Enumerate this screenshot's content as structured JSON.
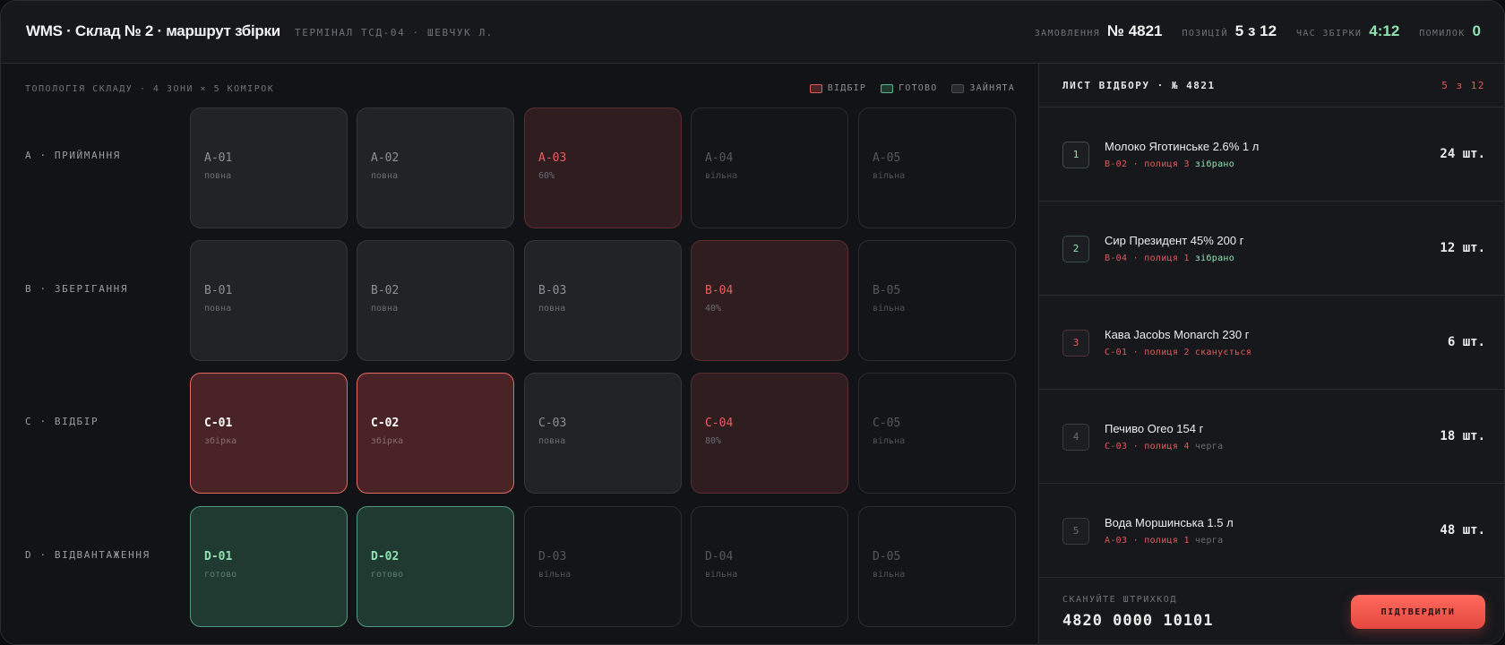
{
  "header": {
    "title": "WMS · Склад № 2 · маршрут збірки",
    "subtitle": "ТЕРМІНАЛ ТСД-04 · ШЕВЧУК Л.",
    "stats": [
      {
        "label": "ЗАМОВЛЕННЯ",
        "value": "№ 4821",
        "color": "#f2f2f2"
      },
      {
        "label": "ПОЗИЦІЙ",
        "value": "5 з 12",
        "color": "#f2f2f2"
      },
      {
        "label": "ЧАС ЗБІРКИ",
        "value": "4:12",
        "color": "#8ee3b1"
      },
      {
        "label": "ПОМИЛОК",
        "value": "0",
        "color": "#8ee3b1"
      }
    ]
  },
  "grid": {
    "topology_label": "ТОПОЛОГІЯ СКЛАДУ · 4 ЗОНИ × 5 КОМІРОК",
    "legend": [
      {
        "label": "ВІДБІР",
        "swatch": "red"
      },
      {
        "label": "ГОТОВО",
        "swatch": "green"
      },
      {
        "label": "ЗАЙНЯТА",
        "swatch": "gray"
      }
    ],
    "zones": [
      {
        "label": "A · ПРИЙМАННЯ",
        "cells": [
          {
            "code": "A-01",
            "sub": "повна",
            "state": "full"
          },
          {
            "code": "A-02",
            "sub": "повна",
            "state": "full"
          },
          {
            "code": "A-03",
            "sub": "60%",
            "state": "partial"
          },
          {
            "code": "A-04",
            "sub": "вільна",
            "state": "free"
          },
          {
            "code": "A-05",
            "sub": "вільна",
            "state": "free"
          }
        ]
      },
      {
        "label": "B · ЗБЕРІГАННЯ",
        "cells": [
          {
            "code": "B-01",
            "sub": "повна",
            "state": "full"
          },
          {
            "code": "B-02",
            "sub": "повна",
            "state": "full"
          },
          {
            "code": "B-03",
            "sub": "повна",
            "state": "full"
          },
          {
            "code": "B-04",
            "sub": "40%",
            "state": "partial"
          },
          {
            "code": "B-05",
            "sub": "вільна",
            "state": "free"
          }
        ]
      },
      {
        "label": "C · ВІДБІР",
        "cells": [
          {
            "code": "C-01",
            "sub": "збірка",
            "state": "pick"
          },
          {
            "code": "C-02",
            "sub": "збірка",
            "state": "pick"
          },
          {
            "code": "C-03",
            "sub": "повна",
            "state": "full"
          },
          {
            "code": "C-04",
            "sub": "80%",
            "state": "partial"
          },
          {
            "code": "C-05",
            "sub": "вільна",
            "state": "free"
          }
        ]
      },
      {
        "label": "D · ВІДВАНТАЖЕННЯ",
        "cells": [
          {
            "code": "D-01",
            "sub": "готово",
            "state": "done"
          },
          {
            "code": "D-02",
            "sub": "готово",
            "state": "done"
          },
          {
            "code": "D-03",
            "sub": "вільна",
            "state": "free"
          },
          {
            "code": "D-04",
            "sub": "вільна",
            "state": "free"
          },
          {
            "code": "D-05",
            "sub": "вільна",
            "state": "free"
          }
        ]
      }
    ]
  },
  "pick_list": {
    "title": "ЛИСТ ВІДБОРУ · № 4821",
    "count": "5 з 12",
    "items": [
      {
        "num": "1",
        "name": "Молоко Яготинське 2.6% 1 л",
        "location": "B-02 · полиця 3",
        "status": "зібрано",
        "status_color": "green",
        "qty": "24 шт."
      },
      {
        "num": "2",
        "name": "Сир Президент 45% 200 г",
        "location": "B-04 · полиця 1",
        "status": "зібрано",
        "status_color": "green",
        "qty": "12 шт."
      },
      {
        "num": "3",
        "name": "Кава Jacobs Monarch 230 г",
        "location": "C-01 · полиця 2",
        "status": "сканується",
        "status_color": "red",
        "qty": "6 шт."
      },
      {
        "num": "4",
        "name": "Печиво Oreo 154 г",
        "location": "C-03 · полиця 4",
        "status": "черга",
        "status_color": "gray",
        "qty": "18 шт."
      },
      {
        "num": "5",
        "name": "Вода Моршинська 1.5 л",
        "location": "A-03 · полиця 1",
        "status": "черга",
        "status_color": "gray",
        "qty": "48 шт."
      }
    ],
    "scan_label": "СКАНУЙТЕ ШТРИХКОД",
    "scan_value": "4820 0000 10101",
    "confirm_label": "ПІДТВЕРДИТИ"
  }
}
